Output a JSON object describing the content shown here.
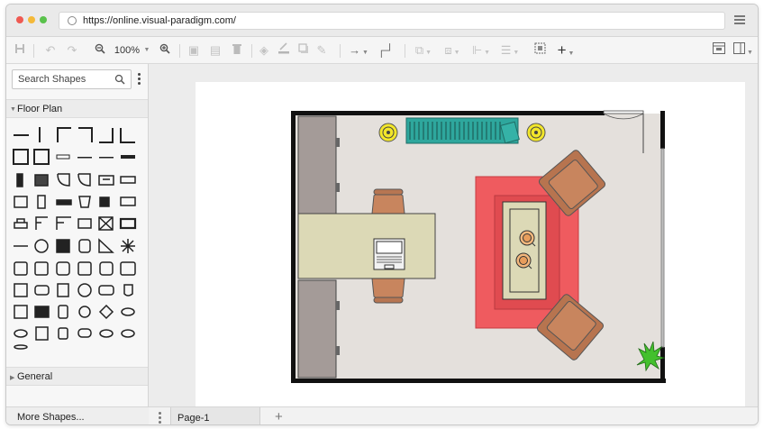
{
  "browser": {
    "url": "https://online.visual-paradigm.com/",
    "dot_colors": [
      "#ef5a52",
      "#f4b93a",
      "#5ac24c"
    ]
  },
  "toolbar": {
    "zoom_label": "100%"
  },
  "sidebar": {
    "search_placeholder": "Search Shapes",
    "sections": [
      {
        "label": "Floor Plan",
        "expanded": true
      },
      {
        "label": "General",
        "expanded": false
      }
    ],
    "more_shapes_label": "More Shapes..."
  },
  "pages": {
    "tabs": [
      {
        "label": "Page-1"
      }
    ],
    "add_symbol": "+"
  },
  "colors": {
    "wall": "#111111",
    "floor": "#e4e0dc",
    "rug": "#ef5b5f",
    "armchair": "#c8855e",
    "desk": "#dcd9b6",
    "cabinet": "#a49b98",
    "radiator": "#2ea79d",
    "lamp": "#f2e62a",
    "plant": "#43c02d"
  }
}
